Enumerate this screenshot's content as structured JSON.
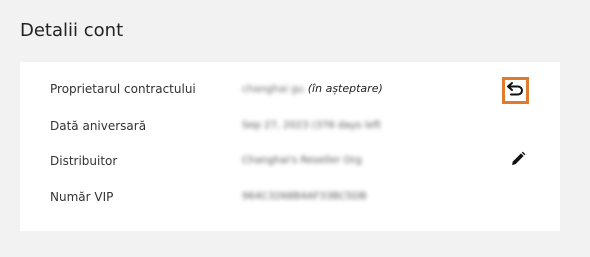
{
  "section": {
    "title": "Detalii cont"
  },
  "rows": [
    {
      "label": "Proprietarul contractului",
      "value": "changhai gu",
      "status": "(în așteptare)",
      "action": "undo-icon"
    },
    {
      "label": "Dată aniversară",
      "value": "Sep 27, 2023 (376 days left"
    },
    {
      "label": "Distribuitor",
      "value": "Changhai's Reseller Org",
      "action": "pencil-icon"
    },
    {
      "label": "Număr VIP",
      "value": "964C3268B4AF33BC5DB"
    }
  ],
  "colors": {
    "highlight": "#e07b2e",
    "background": "#f2f2f2",
    "card": "#ffffff"
  }
}
